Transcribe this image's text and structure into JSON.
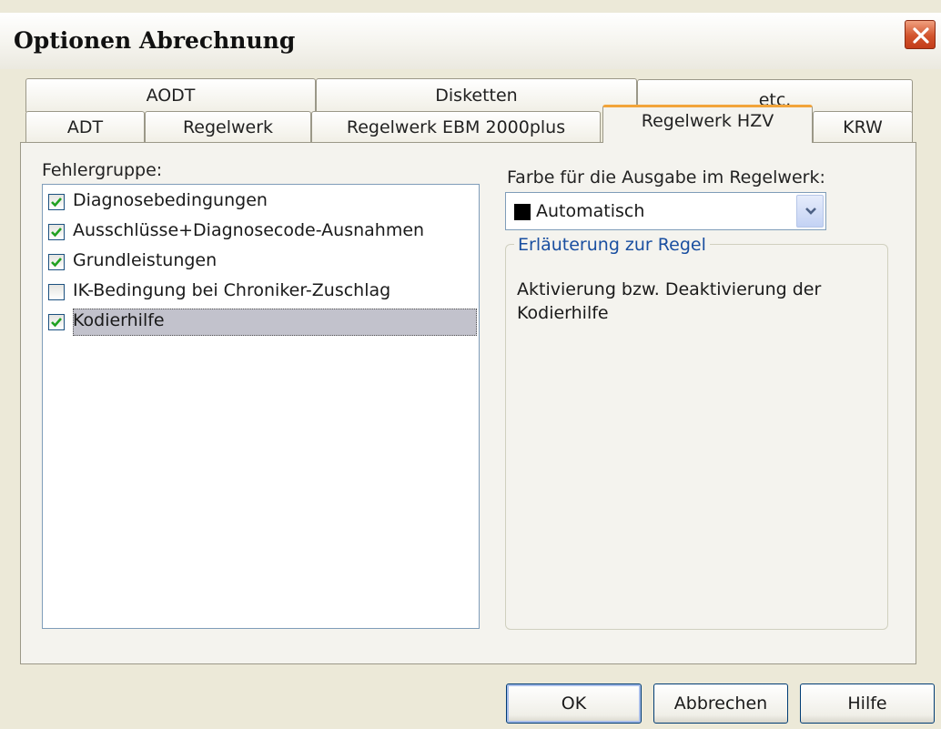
{
  "window": {
    "title": "Optionen Abrechnung",
    "close_icon": "close-x-icon"
  },
  "tabs": {
    "row_back": [
      {
        "label": "AODT"
      },
      {
        "label": "Disketten"
      },
      {
        "label": "etc."
      }
    ],
    "row_front": [
      {
        "label": "ADT"
      },
      {
        "label": "Regelwerk"
      },
      {
        "label": "Regelwerk EBM 2000plus"
      },
      {
        "label": "Regelwerk HZV"
      },
      {
        "label": "KRW"
      }
    ],
    "active": "Regelwerk HZV"
  },
  "left": {
    "label": "Fehlergruppe:",
    "items": [
      {
        "label": "Diagnosebedingungen",
        "checked": true
      },
      {
        "label": "Ausschlüsse+Diagnosecode-Ausnahmen",
        "checked": true
      },
      {
        "label": "Grundleistungen",
        "checked": true
      },
      {
        "label": "IK-Bedingung bei Chroniker-Zuschlag",
        "checked": false
      },
      {
        "label": "Kodierhilfe",
        "checked": true,
        "selected": true
      }
    ]
  },
  "right": {
    "color_label": "Farbe für die Ausgabe im Regelwerk:",
    "color_value": "Automatisch",
    "swatch_color": "#000000",
    "group_title": "Erläuterung zur Regel",
    "description": "Aktivierung bzw. Deaktivierung der Kodierhilfe"
  },
  "buttons": {
    "ok": "OK",
    "cancel": "Abbrechen",
    "help": "Hilfe"
  },
  "colors": {
    "active_tab_accent": "#f2a43a",
    "checkmark": "#21a121",
    "legend_text": "#1a4fa0",
    "close_button": "#d2532c"
  }
}
